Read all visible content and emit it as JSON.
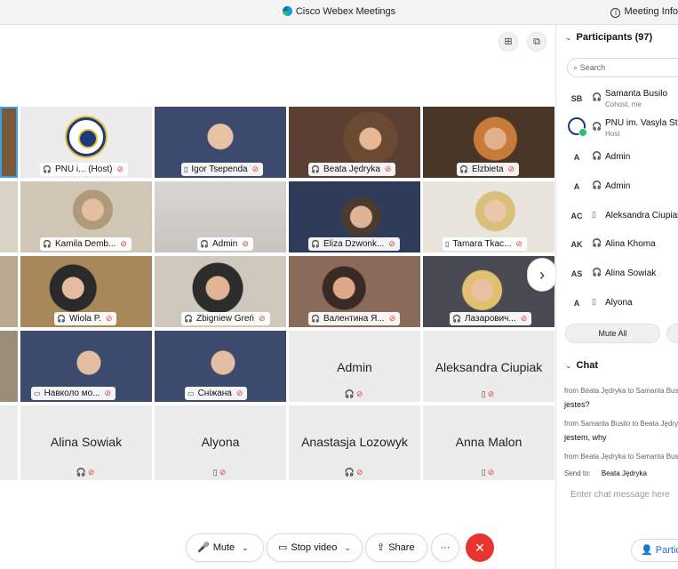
{
  "app": {
    "title": "Cisco Webex Meetings",
    "meeting_info": "Meeting Info"
  },
  "colors": {
    "mute_red": "#e0403a",
    "end_red": "#e8352f",
    "accent_blue": "#1b6fd8"
  },
  "view_controls": {
    "grid_icon": "⊞",
    "layout_icon": "⧉"
  },
  "video_tiles": [
    {
      "name": "PNU i...",
      "suffix": "(Host)",
      "type": "logo",
      "status_icon": "headset-icon"
    },
    {
      "name": "Igor Tsependa",
      "type": "video",
      "status_icon": "video-device-icon"
    },
    {
      "name": "Beata Jędryka",
      "type": "video",
      "status_icon": "headset-icon"
    },
    {
      "name": "Elzbieta",
      "type": "video",
      "status_icon": "headset-icon"
    },
    {
      "name": "Kamila Demb...",
      "type": "video",
      "status_icon": "headset-icon"
    },
    {
      "name": "Admin",
      "type": "video",
      "status_icon": "headset-icon"
    },
    {
      "name": "Eliza Dzwonk...",
      "type": "video",
      "status_icon": "headset-icon"
    },
    {
      "name": "Tamara Tkac...",
      "type": "video",
      "status_icon": "phone-icon"
    },
    {
      "name": "Wiola P.",
      "type": "video",
      "status_icon": "headset-icon"
    },
    {
      "name": "Zbigniew Greń",
      "type": "video",
      "status_icon": "headset-icon"
    },
    {
      "name": "Валентина Я...",
      "type": "video",
      "status_icon": "headset-icon"
    },
    {
      "name": "Лазарович...",
      "type": "video",
      "status_icon": "headset-icon"
    },
    {
      "name": "Навколо мо...",
      "type": "video",
      "status_icon": "screen-icon"
    },
    {
      "name": "Сніжана",
      "type": "video",
      "status_icon": "screen-icon"
    }
  ],
  "blank_tiles": [
    {
      "name": "Admin"
    },
    {
      "name": "Aleksandra Ciupiak"
    },
    {
      "name": "Alina Sowiak"
    },
    {
      "name": "Alyona"
    },
    {
      "name": "Anastasja Lozowyk"
    },
    {
      "name": "Anna Malon"
    }
  ],
  "controls": {
    "mute": "Mute",
    "stop_video": "Stop video",
    "share": "Share",
    "more": "···",
    "end": "✕"
  },
  "participants": {
    "header": "Participants (97)",
    "search_placeholder": "Search",
    "mute_all": "Mute All",
    "list": [
      {
        "initials": "SB",
        "name": "Samanta Busilo",
        "role": "Cohost, me"
      },
      {
        "initials": "",
        "name": "PNU im. Vasyla Stefanyka",
        "role": "Host"
      },
      {
        "initials": "A",
        "name": "Admin",
        "role": ""
      },
      {
        "initials": "A",
        "name": "Admin",
        "role": ""
      },
      {
        "initials": "AC",
        "name": "Aleksandra Ciupiak",
        "role": ""
      },
      {
        "initials": "AK",
        "name": "Alina Khoma",
        "role": ""
      },
      {
        "initials": "AS",
        "name": "Alina Sowiak",
        "role": ""
      },
      {
        "initials": "A",
        "name": "Alyona",
        "role": ""
      }
    ]
  },
  "chat": {
    "header": "Chat",
    "messages": [
      {
        "meta": "from Beata Jędryka to Samanta Busilo",
        "text": "jestes?"
      },
      {
        "meta": "from Samanta Busilo to Beata Jędryka",
        "text": "jestem, why"
      },
      {
        "meta": "from Beata Jędryka to Samanta Busilo",
        "text": ""
      }
    ],
    "send_to_label": "Send to:",
    "send_to_value": "Beata Jędryka",
    "input_placeholder": "Enter chat message here",
    "participants_button": "Participants"
  }
}
